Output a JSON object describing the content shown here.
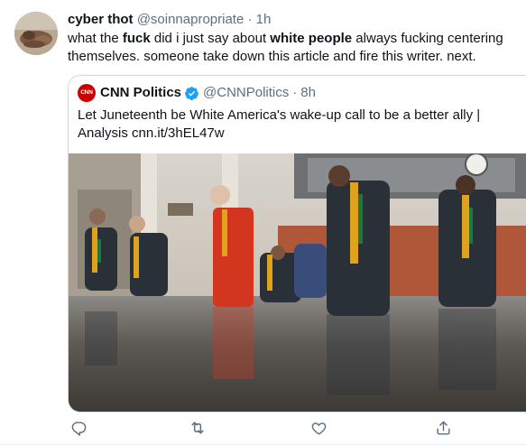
{
  "tweet": {
    "display_name": "cyber thot",
    "handle": "@soinnapropriate",
    "separator": "·",
    "time": "1h",
    "text_parts": [
      "what the ",
      "fuck",
      " did i just say about ",
      "white people",
      " always fucking centering themselves. someone take down this article and fire this writer. next."
    ]
  },
  "quoted": {
    "logo_text": "CNN",
    "display_name": "CNN Politics",
    "handle": "@CNNPolitics",
    "separator": "·",
    "time": "8h",
    "text": "Let Juneteenth be White America's wake-up call to be a better ally | Analysis cnn.it/3hEL47w"
  },
  "actions": {
    "reply_icon": "reply-icon",
    "retweet_icon": "retweet-icon",
    "like_icon": "like-icon",
    "share_icon": "share-icon"
  },
  "colors": {
    "accent": "#1da1f2",
    "secondary_text": "#5b7083",
    "cnn_red": "#cc0000"
  }
}
